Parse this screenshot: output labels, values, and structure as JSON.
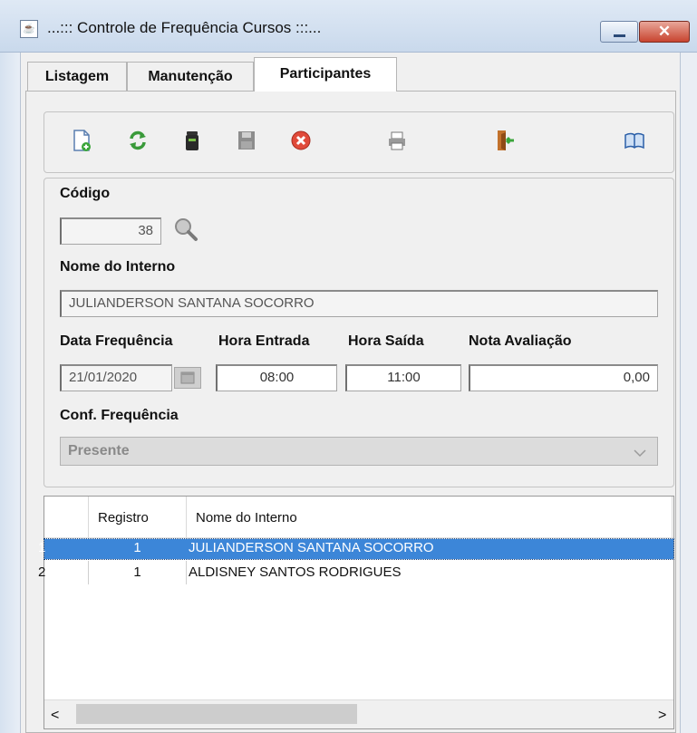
{
  "window": {
    "title": "...::: Controle de Frequência Cursos :::...",
    "close_glyph": "✕"
  },
  "tabs": [
    {
      "label": "Listagem",
      "active": false
    },
    {
      "label": "Manutenção",
      "active": false
    },
    {
      "label": "Participantes",
      "active": true
    }
  ],
  "toolbar": {
    "icons": [
      "new-document-icon",
      "refresh-icon",
      "trash-icon",
      "save-icon",
      "cancel-icon",
      "print-icon",
      "exit-icon",
      "help-book-icon"
    ]
  },
  "form": {
    "codigo_label": "Código",
    "codigo_value": "38",
    "nome_label": "Nome do Interno",
    "nome_value": "JULIANDERSON SANTANA SOCORRO",
    "data_label": "Data Frequência",
    "data_value": "21/01/2020",
    "hora_entrada_label": "Hora Entrada",
    "hora_entrada_value": "08:00",
    "hora_saida_label": "Hora Saída",
    "hora_saida_value": "11:00",
    "nota_label": "Nota Avaliação",
    "nota_value": "0,00",
    "conf_label": "Conf. Frequência",
    "conf_value": "Presente"
  },
  "table": {
    "columns": [
      "Registro",
      "Nome do Interno"
    ],
    "rows": [
      {
        "idx": "1",
        "registro": "1",
        "nome": "JULIANDERSON SANTANA SOCORRO",
        "selected": true
      },
      {
        "idx": "2",
        "registro": "1",
        "nome": "ALDISNEY SANTOS RODRIGUES",
        "selected": false
      }
    ]
  },
  "scroll": {
    "left_glyph": "<",
    "right_glyph": ">"
  },
  "colors": {
    "selection": "#3c86d8",
    "accent": "#2b6cc4"
  }
}
